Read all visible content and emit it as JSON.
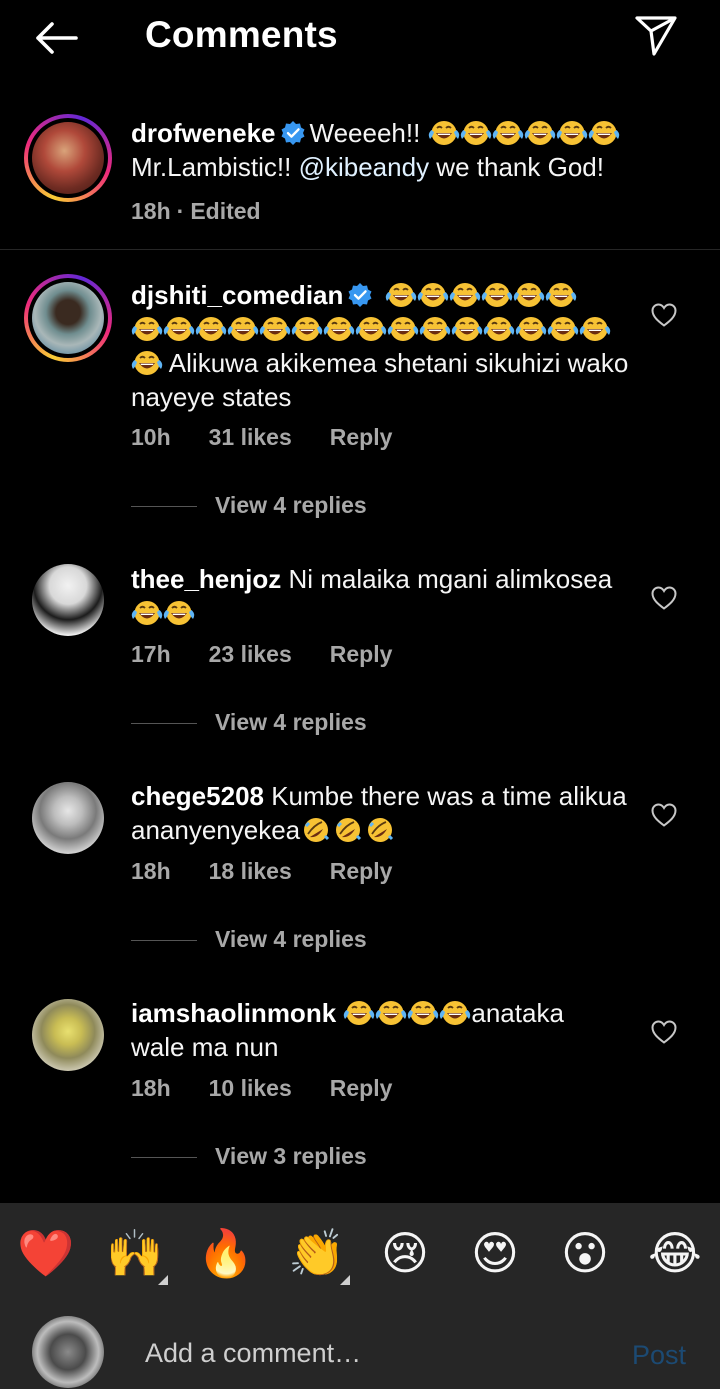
{
  "header": {
    "title": "Comments"
  },
  "caption": {
    "username": "drofweneke",
    "text_before_emoji": "Weeeeh!!",
    "text_line2_a": "Mr.Lambistic!! ",
    "mention": "@kibeandy",
    "text_line2_b": " we thank God!",
    "time": "18h",
    "separator": "·",
    "edited": "Edited"
  },
  "comments": [
    {
      "username": "djshiti_comedian",
      "text": "Alikuwa akikemea shetani sikuhizi wako nayeye states",
      "time": "10h",
      "likes": "31 likes",
      "reply": "Reply",
      "view_replies": "View 4 replies"
    },
    {
      "username": "thee_henjoz",
      "text": "Ni malaika mgani alimkosea",
      "time": "17h",
      "likes": "23 likes",
      "reply": "Reply",
      "view_replies": "View 4 replies"
    },
    {
      "username": "chege5208",
      "text": "Kumbe there was a time alikua ananyenyekea",
      "time": "18h",
      "likes": "18 likes",
      "reply": "Reply",
      "view_replies": "View 4 replies"
    },
    {
      "username": "iamshaolinmonk",
      "text_a": "anataka",
      "text_b": "wale ma nun",
      "time": "18h",
      "likes": "10 likes",
      "reply": "Reply",
      "view_replies": "View 3 replies"
    }
  ],
  "reactions": [
    {
      "emoji": "❤️",
      "name": "red-heart"
    },
    {
      "emoji": "🙌",
      "name": "raising-hands"
    },
    {
      "emoji": "🔥",
      "name": "fire"
    },
    {
      "emoji": "👏",
      "name": "clapping-hands"
    },
    {
      "emoji": "😢",
      "name": "crying-face"
    },
    {
      "emoji": "😍",
      "name": "heart-eyes"
    },
    {
      "emoji": "😮",
      "name": "surprised-face"
    },
    {
      "emoji": "😂",
      "name": "tears-of-joy"
    }
  ],
  "composer": {
    "placeholder": "Add a comment…",
    "post_label": "Post"
  },
  "icons": {
    "back": "arrow-left-icon",
    "share": "paper-plane-icon",
    "verified": "verified-badge-icon",
    "like": "heart-outline-icon"
  },
  "colors": {
    "background": "#000000",
    "secondary_text": "#a8a8a8",
    "verified_blue": "#3897f0",
    "post_disabled": "#1c4a73",
    "bar_background": "#262626"
  }
}
